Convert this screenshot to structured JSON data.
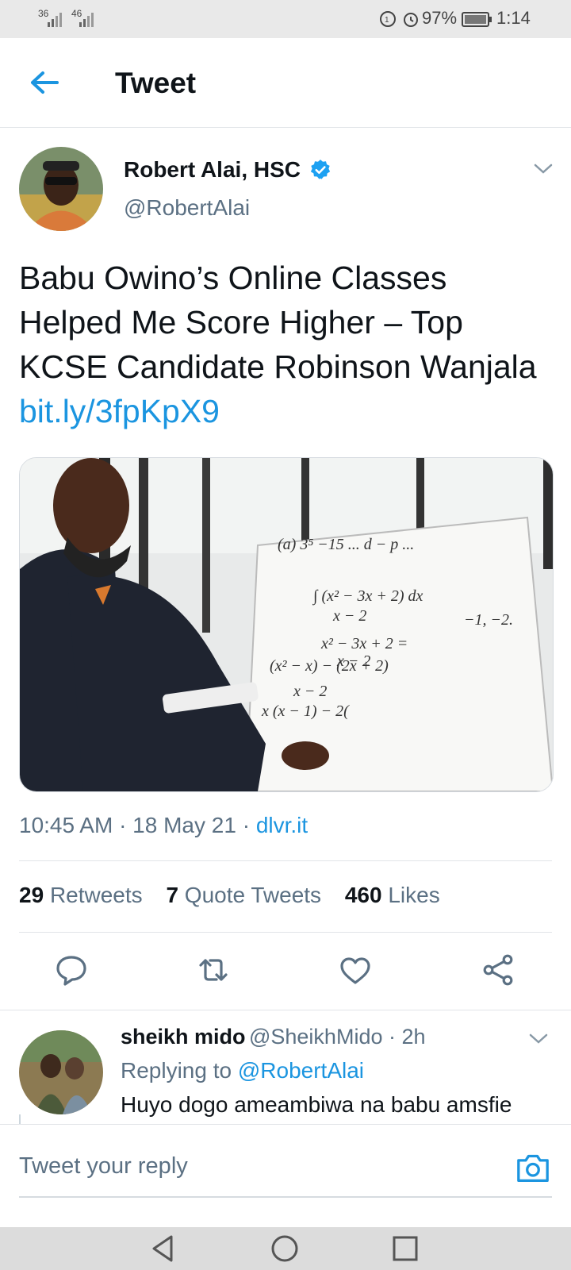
{
  "status_bar": {
    "signal_1": "36",
    "signal_2": "46",
    "battery": "97%",
    "time": "1:14"
  },
  "header": {
    "title": "Tweet"
  },
  "tweet": {
    "author_name": "Robert Alai, HSC",
    "author_handle": "@RobertAlai",
    "text": "Babu Owino’s Online Classes Helped Me Score Higher – Top KCSE Candidate Robinson Wanjala ",
    "link": "bit.ly/3fpKpX9",
    "time": "10:45 AM · 18 May 21 · ",
    "source": "dlvr.it",
    "retweets_count": "29",
    "retweets_label": "Retweets",
    "quotes_count": "7",
    "quotes_label": "Quote Tweets",
    "likes_count": "460",
    "likes_label": "Likes"
  },
  "reply": {
    "author_name": "sheikh mido",
    "author_handle": "@SheikhMido · 2h",
    "replying_label": "Replying to ",
    "replying_to": "@RobertAlai",
    "text": "Huyo dogo ameambiwa na babu amsfie"
  },
  "composer": {
    "placeholder": "Tweet your reply"
  },
  "colors": {
    "accent": "#1b95e0",
    "muted": "#5b7083",
    "text": "#0f1419"
  },
  "icons": [
    "back-arrow-icon",
    "verified-badge-icon",
    "chevron-down-icon",
    "comment-icon",
    "retweet-icon",
    "like-icon",
    "share-icon",
    "camera-icon",
    "nav-back-icon",
    "nav-home-icon",
    "nav-recents-icon"
  ]
}
